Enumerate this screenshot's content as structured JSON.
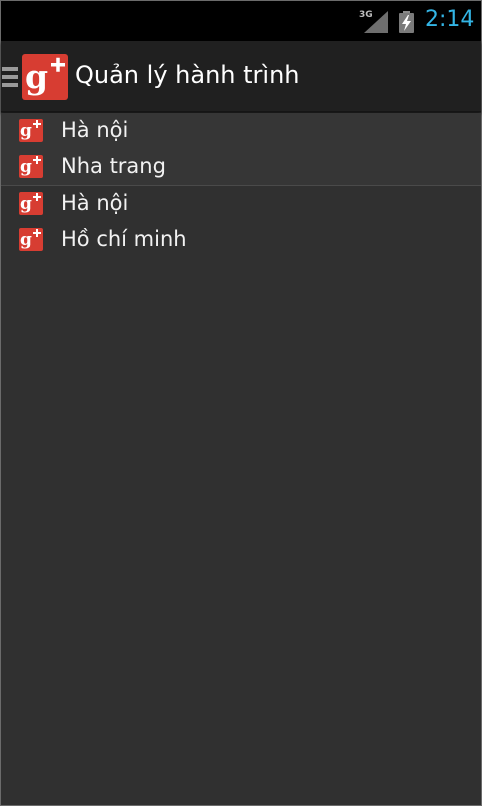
{
  "status_bar": {
    "network": "3G",
    "time": "2:14",
    "accent_color": "#33b5e5"
  },
  "action_bar": {
    "title": "Quản lý hành trình",
    "app_icon": "google-plus-icon",
    "nav_icon": "drawer-menu-icon"
  },
  "groups": [
    {
      "items": [
        {
          "label": "Hà nội",
          "icon": "google-plus-icon"
        },
        {
          "label": "Nha trang",
          "icon": "google-plus-icon"
        }
      ]
    },
    {
      "items": [
        {
          "label": "Hà nội",
          "icon": "google-plus-icon"
        },
        {
          "label": "Hồ chí minh",
          "icon": "google-plus-icon"
        }
      ]
    }
  ],
  "colors": {
    "background": "#303030",
    "icon_red": "#d73d32"
  }
}
